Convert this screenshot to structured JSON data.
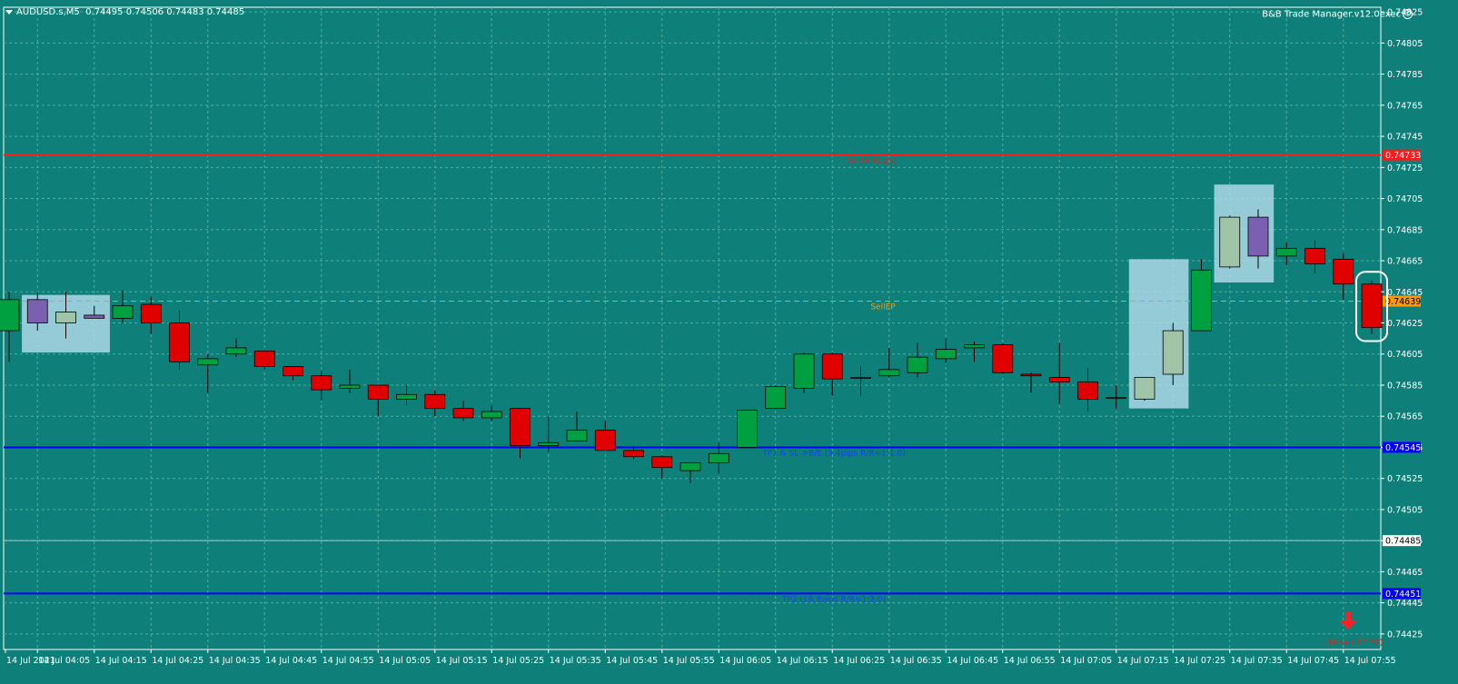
{
  "header": {
    "symbol": "AUDUSD.s,M5",
    "ohlc": "0.74495 0.74506 0.74483 0.74485",
    "ea_name": "B&B Trade Manager.v12.0exec"
  },
  "colors": {
    "background": "#0e8079",
    "grid": "#4cae9f",
    "bull": "#00a040",
    "bear": "#e00000",
    "sl_line": "#ff1a1a",
    "tp_line": "#0000ff",
    "entry_line": "#ff9900",
    "zone": "#add8e6"
  },
  "price_axis": {
    "ticks": [
      "0.74825",
      "0.74805",
      "0.74785",
      "0.74765",
      "0.74745",
      "0.74725",
      "0.74705",
      "0.74685",
      "0.74665",
      "0.74645",
      "0.74625",
      "0.74605",
      "0.74585",
      "0.74565",
      "0.74545",
      "0.74525",
      "0.74505",
      "0.74485",
      "0.74465",
      "0.74445",
      "0.74425"
    ],
    "current_price": "0.74485"
  },
  "time_axis": {
    "labels": [
      "14 Jul 2021",
      "14 Jul 04:05",
      "14 Jul 04:15",
      "14 Jul 04:25",
      "14 Jul 04:35",
      "14 Jul 04:45",
      "14 Jul 04:55",
      "14 Jul 05:05",
      "14 Jul 05:15",
      "14 Jul 05:25",
      "14 Jul 05:35",
      "14 Jul 05:45",
      "14 Jul 05:55",
      "14 Jul 06:05",
      "14 Jul 06:15",
      "14 Jul 06:25",
      "14 Jul 06:35",
      "14 Jul 06:45",
      "14 Jul 06:55",
      "14 Jul 07:05",
      "14 Jul 07:15",
      "14 Jul 07:25",
      "14 Jul 07:35",
      "14 Jul 07:45",
      "14 Jul 07:55"
    ]
  },
  "levels": {
    "sl": {
      "price": 0.74733,
      "label": "SL (9.4pips)",
      "tag": "0.74733"
    },
    "entry": {
      "price": 0.74639,
      "label": "SellEP",
      "tag": "0.74639"
    },
    "tp1": {
      "price": 0.74545,
      "label": "TP1 & SL->B/E (9.4pips R/R=1:1.0)",
      "tag": "0.74545"
    },
    "tp2": {
      "price": 0.74451,
      "label": "TP2 (18.8pips R/R=1:2.0)",
      "tag": "0.74451"
    }
  },
  "countdown": "(16min 07:30)",
  "chart_data": {
    "type": "candlestick",
    "x_unit": "bar index (5 min)",
    "y_range": [
      0.74415,
      0.74828
    ],
    "candles": [
      {
        "o": 0.7462,
        "h": 0.74645,
        "l": 0.746,
        "c": 0.7464
      },
      {
        "o": 0.7464,
        "h": 0.74645,
        "l": 0.7462,
        "c": 0.74625
      },
      {
        "o": 0.74625,
        "h": 0.74645,
        "l": 0.74615,
        "c": 0.74632
      },
      {
        "o": 0.7463,
        "h": 0.74636,
        "l": 0.74628,
        "c": 0.74628
      },
      {
        "o": 0.74628,
        "h": 0.74646,
        "l": 0.74625,
        "c": 0.74636
      },
      {
        "o": 0.74637,
        "h": 0.74642,
        "l": 0.74618,
        "c": 0.74625
      },
      {
        "o": 0.74625,
        "h": 0.74633,
        "l": 0.74595,
        "c": 0.746
      },
      {
        "o": 0.74598,
        "h": 0.74605,
        "l": 0.7458,
        "c": 0.74602
      },
      {
        "o": 0.74605,
        "h": 0.74615,
        "l": 0.74603,
        "c": 0.74609
      },
      {
        "o": 0.74607,
        "h": 0.74607,
        "l": 0.74595,
        "c": 0.74597
      },
      {
        "o": 0.74597,
        "h": 0.74596,
        "l": 0.74588,
        "c": 0.74591
      },
      {
        "o": 0.74591,
        "h": 0.74594,
        "l": 0.74575,
        "c": 0.74582
      },
      {
        "o": 0.74583,
        "h": 0.74595,
        "l": 0.7458,
        "c": 0.74585
      },
      {
        "o": 0.74585,
        "h": 0.74585,
        "l": 0.74565,
        "c": 0.74576
      },
      {
        "o": 0.74576,
        "h": 0.74585,
        "l": 0.74572,
        "c": 0.74579
      },
      {
        "o": 0.74579,
        "h": 0.74582,
        "l": 0.74565,
        "c": 0.7457
      },
      {
        "o": 0.7457,
        "h": 0.74575,
        "l": 0.74562,
        "c": 0.74564
      },
      {
        "o": 0.74564,
        "h": 0.74572,
        "l": 0.74562,
        "c": 0.74568
      },
      {
        "o": 0.7457,
        "h": 0.7457,
        "l": 0.74538,
        "c": 0.74546
      },
      {
        "o": 0.74546,
        "h": 0.74565,
        "l": 0.74542,
        "c": 0.74548
      },
      {
        "o": 0.74549,
        "h": 0.74568,
        "l": 0.74549,
        "c": 0.74556
      },
      {
        "o": 0.74556,
        "h": 0.74562,
        "l": 0.74545,
        "c": 0.74543
      },
      {
        "o": 0.74543,
        "h": 0.74546,
        "l": 0.74537,
        "c": 0.74539
      },
      {
        "o": 0.74539,
        "h": 0.7454,
        "l": 0.74525,
        "c": 0.74532
      },
      {
        "o": 0.7453,
        "h": 0.74535,
        "l": 0.74522,
        "c": 0.74535
      },
      {
        "o": 0.74535,
        "h": 0.74548,
        "l": 0.74528,
        "c": 0.74541
      },
      {
        "o": 0.74545,
        "h": 0.74569,
        "l": 0.74545,
        "c": 0.74569
      },
      {
        "o": 0.7457,
        "h": 0.74585,
        "l": 0.7457,
        "c": 0.74584
      },
      {
        "o": 0.74583,
        "h": 0.74606,
        "l": 0.7458,
        "c": 0.74605
      },
      {
        "o": 0.74605,
        "h": 0.74606,
        "l": 0.74578,
        "c": 0.74589
      },
      {
        "o": 0.7459,
        "h": 0.74597,
        "l": 0.74578,
        "c": 0.7459
      },
      {
        "o": 0.74591,
        "h": 0.74609,
        "l": 0.7459,
        "c": 0.74595
      },
      {
        "o": 0.74593,
        "h": 0.74612,
        "l": 0.7459,
        "c": 0.74603
      },
      {
        "o": 0.74602,
        "h": 0.74615,
        "l": 0.74599,
        "c": 0.74608
      },
      {
        "o": 0.74609,
        "h": 0.74613,
        "l": 0.746,
        "c": 0.74611
      },
      {
        "o": 0.74611,
        "h": 0.74612,
        "l": 0.74592,
        "c": 0.74593
      },
      {
        "o": 0.74592,
        "h": 0.74593,
        "l": 0.7458,
        "c": 0.74591
      },
      {
        "o": 0.7459,
        "h": 0.74612,
        "l": 0.74573,
        "c": 0.74587
      },
      {
        "o": 0.74587,
        "h": 0.74596,
        "l": 0.74568,
        "c": 0.74576
      },
      {
        "o": 0.74577,
        "h": 0.74585,
        "l": 0.7457,
        "c": 0.74577
      },
      {
        "o": 0.74576,
        "h": 0.7459,
        "l": 0.74575,
        "c": 0.7459
      },
      {
        "o": 0.74592,
        "h": 0.74625,
        "l": 0.74585,
        "c": 0.7462
      },
      {
        "o": 0.7462,
        "h": 0.74666,
        "l": 0.7462,
        "c": 0.74659
      },
      {
        "o": 0.74661,
        "h": 0.74694,
        "l": 0.7466,
        "c": 0.74693
      },
      {
        "o": 0.74693,
        "h": 0.74698,
        "l": 0.7466,
        "c": 0.74668
      },
      {
        "o": 0.74668,
        "h": 0.74677,
        "l": 0.74662,
        "c": 0.74673
      },
      {
        "o": 0.74673,
        "h": 0.74678,
        "l": 0.74657,
        "c": 0.74663
      },
      {
        "o": 0.74666,
        "h": 0.7467,
        "l": 0.7464,
        "c": 0.7465
      },
      {
        "o": 0.7465,
        "h": 0.74652,
        "l": 0.74618,
        "c": 0.74622
      }
    ],
    "highlight_zones": [
      {
        "from_bar": 1,
        "to_bar": 3,
        "low": 0.74606,
        "high": 0.74643
      },
      {
        "from_bar": 40,
        "to_bar": 41,
        "low": 0.7457,
        "high": 0.74666
      },
      {
        "from_bar": 43,
        "to_bar": 44,
        "low": 0.74651,
        "high": 0.74714
      }
    ]
  }
}
